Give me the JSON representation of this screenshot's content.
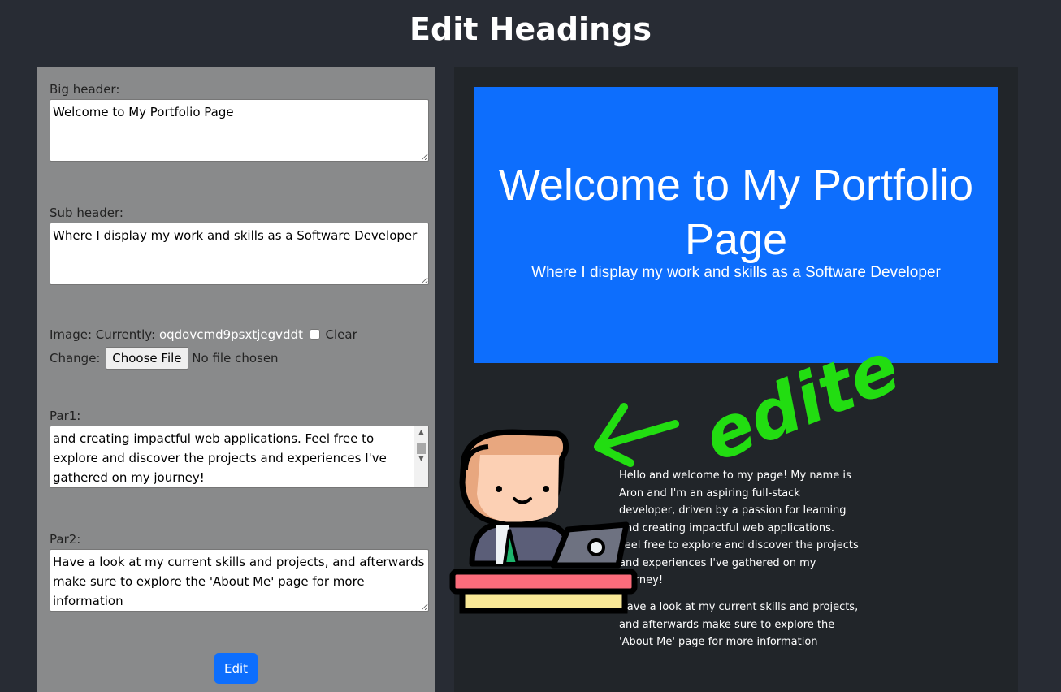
{
  "page": {
    "title": "Edit Headings"
  },
  "form": {
    "big_header_label": "Big header:",
    "big_header_value": "Welcome to My Portfolio Page",
    "sub_header_label": "Sub header:",
    "sub_header_value": "Where I display my work and skills as a Software Developer",
    "image_label": "Image: Currently:",
    "image_current": "oqdovcmd9psxtjegvddt",
    "clear_label": "Clear",
    "change_label": "Change:",
    "choose_file_label": "Choose File",
    "no_file_text": "No file chosen",
    "par1_label": "Par1:",
    "par1_value": "and creating impactful web applications. Feel free to explore and discover the projects and experiences I've gathered on my journey!",
    "par2_label": "Par2:",
    "par2_value": "Have a look at my current skills and projects, and afterwards make sure to explore the 'About Me' page for more information",
    "edit_button": "Edit"
  },
  "preview": {
    "hero_title": "Welcome to My Portfolio Page",
    "hero_subtitle": "Where I display my work and skills as a Software Developer",
    "par1": "Hello and welcome to my page! My name is Aron and I'm an aspiring full-stack developer, driven by a passion for learning and creating impactful web applications. Feel free to explore and discover the projects and experiences I've gathered on my journey!",
    "par2": "Have a look at my current skills and projects, and afterwards make sure to explore the 'About Me' page for more information"
  },
  "annotation": {
    "text": "edited",
    "color": "#22dd11"
  },
  "colors": {
    "accent": "#0d6efd",
    "background": "#282c34",
    "panel": "#898a8b",
    "preview_bg": "#212529"
  },
  "icons": {
    "mascot": "developer-at-laptop-icon",
    "arrow": "left-arrow-icon"
  }
}
